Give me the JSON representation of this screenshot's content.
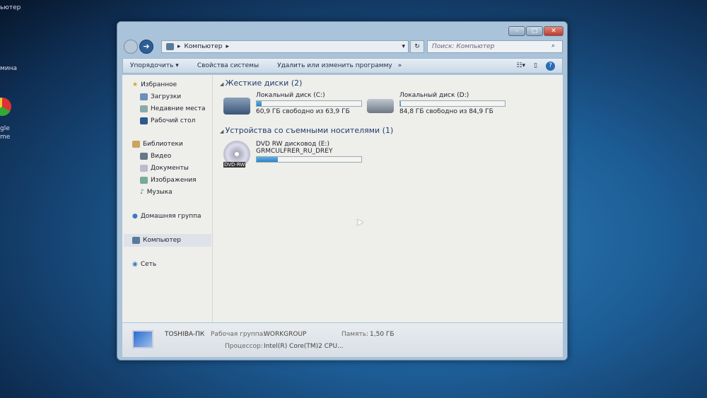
{
  "desktop": {
    "left_texts": [
      "ьютер",
      "мина",
      "gle",
      "me"
    ]
  },
  "window": {
    "controls": {
      "minimize": "–",
      "maximize": "□",
      "close": "✕"
    },
    "address": {
      "path": [
        "Компьютер"
      ],
      "icon": "computer-icon"
    },
    "search": {
      "placeholder": "Поиск: Компьютер"
    },
    "toolbar": {
      "organize": "Упорядочить ▾",
      "system_properties": "Свойства системы",
      "uninstall": "Удалить или изменить программу",
      "more": "»"
    },
    "nav": {
      "favorites": "Избранное",
      "downloads": "Загрузки",
      "recent": "Недавние места",
      "desktop": "Рабочий стол",
      "libraries": "Библиотеки",
      "video": "Видео",
      "documents": "Документы",
      "images": "Изображения",
      "music": "Музыка",
      "homegroup": "Домашняя группа",
      "computer": "Компьютер",
      "network": "Сеть"
    },
    "groups": {
      "hdd": "Жесткие диски (2)",
      "removable": "Устройства со съемными носителями (1)"
    },
    "drives": [
      {
        "name": "Локальный диск (C:)",
        "info": "60,9 ГБ свободно из 63,9 ГБ",
        "used_percent": 4.7
      },
      {
        "name": "Локальный диск (D:)",
        "info": "84,8 ГБ свободно из 84,9 ГБ",
        "used_percent": 0.1
      },
      {
        "name": "DVD RW дисковод (E:)",
        "info": "GRMCULFRER_RU_DREY",
        "used_percent": 20,
        "badge": "DVD-RW"
      }
    ],
    "details": {
      "pc_name": "TOSHIBA-ПК",
      "workgroup_label": "Рабочая группа:",
      "workgroup": "WORKGROUP",
      "memory_label": "Память:",
      "memory": "1,50 ГБ",
      "cpu_label": "Процессор:",
      "cpu": "Intel(R) Core(TM)2 CPU..."
    }
  }
}
